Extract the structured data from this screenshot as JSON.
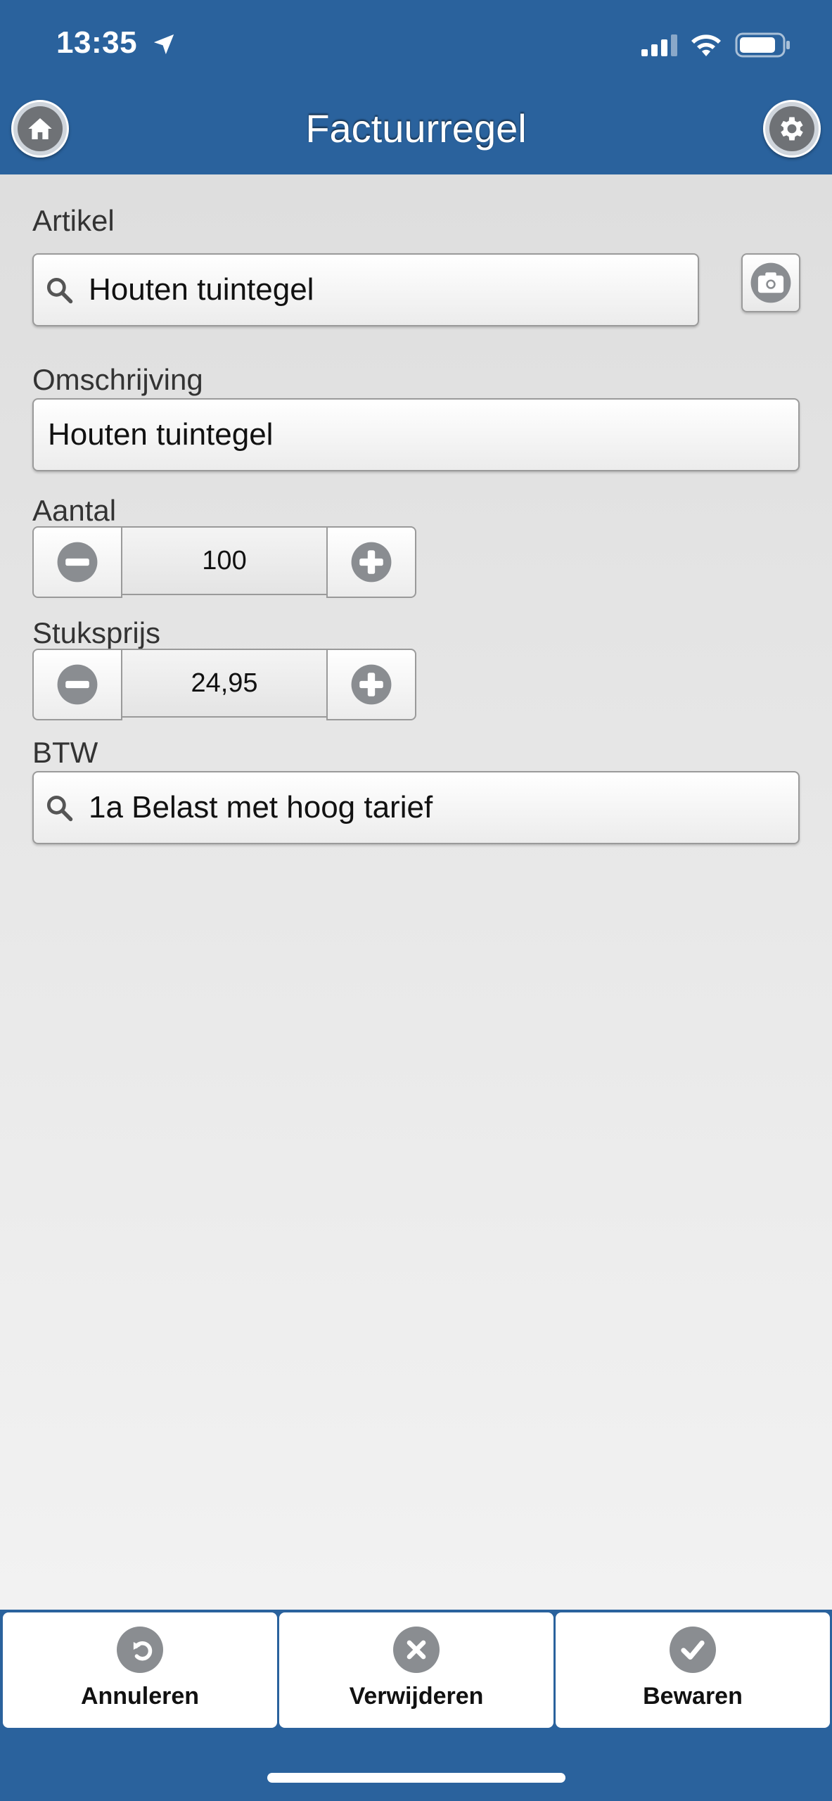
{
  "status_bar": {
    "time": "13:35"
  },
  "nav": {
    "title": "Factuurregel"
  },
  "form": {
    "artikel": {
      "label": "Artikel",
      "value": "Houten tuintegel"
    },
    "omschrijving": {
      "label": "Omschrijving",
      "value": "Houten tuintegel"
    },
    "aantal": {
      "label": "Aantal",
      "value": "100"
    },
    "stuksprijs": {
      "label": "Stuksprijs",
      "value": "24,95"
    },
    "btw": {
      "label": "BTW",
      "value": "1a Belast met hoog tarief"
    }
  },
  "toolbar": {
    "cancel_label": "Annuleren",
    "delete_label": "Verwijderen",
    "save_label": "Bewaren"
  },
  "colors": {
    "brand": "#2a629d",
    "icon_gray": "#8a8d91"
  }
}
